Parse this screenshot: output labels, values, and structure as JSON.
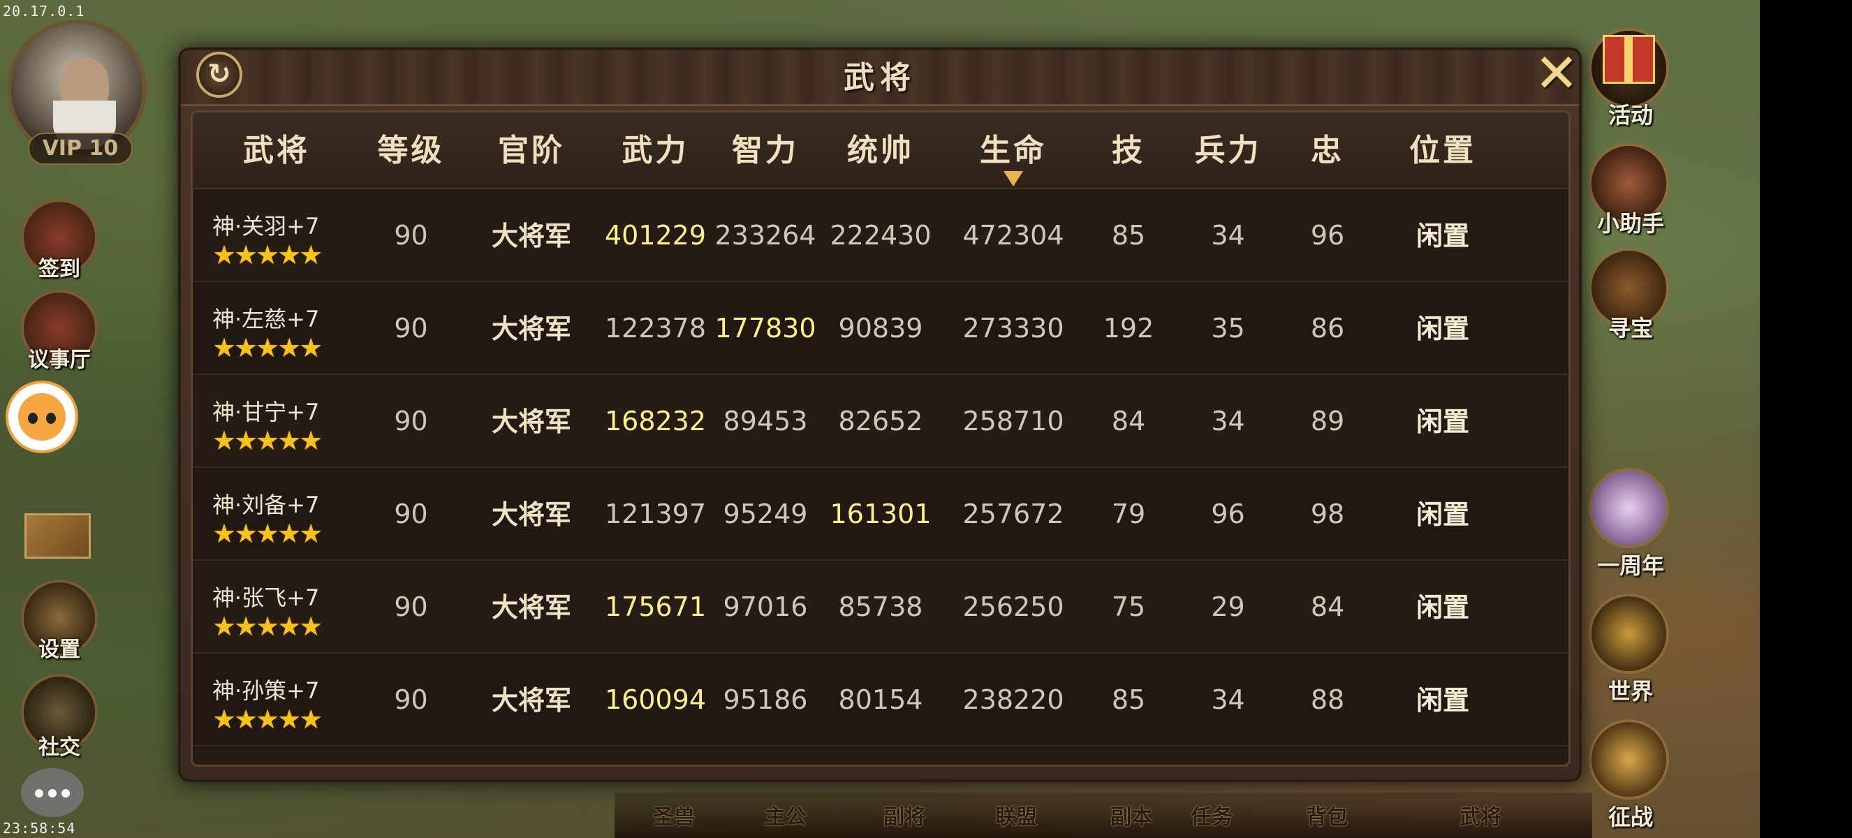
{
  "status_bar": {
    "ip_text": "20.17.0.1",
    "clock": "23:58:54"
  },
  "player": {
    "vip_label": "VIP 10"
  },
  "left_menu": [
    {
      "name": "checkin",
      "label": "签到"
    },
    {
      "name": "council",
      "label": "议事厅"
    },
    {
      "name": "settings",
      "label": "设置"
    },
    {
      "name": "social",
      "label": "社交"
    }
  ],
  "right_menu": [
    {
      "name": "events",
      "label": "活动"
    },
    {
      "name": "helper",
      "label": "小助手"
    },
    {
      "name": "treasure",
      "label": "寻宝"
    },
    {
      "name": "anniversary",
      "label": "一周年"
    },
    {
      "name": "world",
      "label": "世界"
    },
    {
      "name": "expedition",
      "label": "征战"
    }
  ],
  "bottom_menu": [
    "圣兽",
    "主公",
    "副将",
    "联盟",
    "副本",
    "任务",
    "背包",
    "武将"
  ],
  "dialog": {
    "title": "武将",
    "refresh_icon": "refresh-icon",
    "close_icon": "close-icon",
    "columns": [
      "武将",
      "等级",
      "官阶",
      "武力",
      "智力",
      "统帅",
      "生命",
      "技",
      "兵力",
      "忠",
      "位置"
    ],
    "sorted_column": "生命",
    "rows": [
      {
        "name": "神·关羽+7",
        "stars": 5,
        "level": "90",
        "rank": "大将军",
        "force": "401229",
        "intellect": "233264",
        "command": "222430",
        "hp": "472304",
        "skill": "85",
        "troops": "34",
        "loyalty": "96",
        "position": "闲置",
        "highlight": "force"
      },
      {
        "name": "神·左慈+7",
        "stars": 5,
        "level": "90",
        "rank": "大将军",
        "force": "122378",
        "intellect": "177830",
        "command": "90839",
        "hp": "273330",
        "skill": "192",
        "troops": "35",
        "loyalty": "86",
        "position": "闲置",
        "highlight": "intellect"
      },
      {
        "name": "神·甘宁+7",
        "stars": 5,
        "level": "90",
        "rank": "大将军",
        "force": "168232",
        "intellect": "89453",
        "command": "82652",
        "hp": "258710",
        "skill": "84",
        "troops": "34",
        "loyalty": "89",
        "position": "闲置",
        "highlight": "force"
      },
      {
        "name": "神·刘备+7",
        "stars": 5,
        "level": "90",
        "rank": "大将军",
        "force": "121397",
        "intellect": "95249",
        "command": "161301",
        "hp": "257672",
        "skill": "79",
        "troops": "96",
        "loyalty": "98",
        "position": "闲置",
        "highlight": "command"
      },
      {
        "name": "神·张飞+7",
        "stars": 5,
        "level": "90",
        "rank": "大将军",
        "force": "175671",
        "intellect": "97016",
        "command": "85738",
        "hp": "256250",
        "skill": "75",
        "troops": "29",
        "loyalty": "84",
        "position": "闲置",
        "highlight": "force"
      },
      {
        "name": "神·孙策+7",
        "stars": 5,
        "level": "90",
        "rank": "大将军",
        "force": "160094",
        "intellect": "95186",
        "command": "80154",
        "hp": "238220",
        "skill": "85",
        "troops": "34",
        "loyalty": "88",
        "position": "闲置",
        "highlight": "force"
      }
    ],
    "star_glyph": "★",
    "highlight_color": "#fff08a"
  }
}
